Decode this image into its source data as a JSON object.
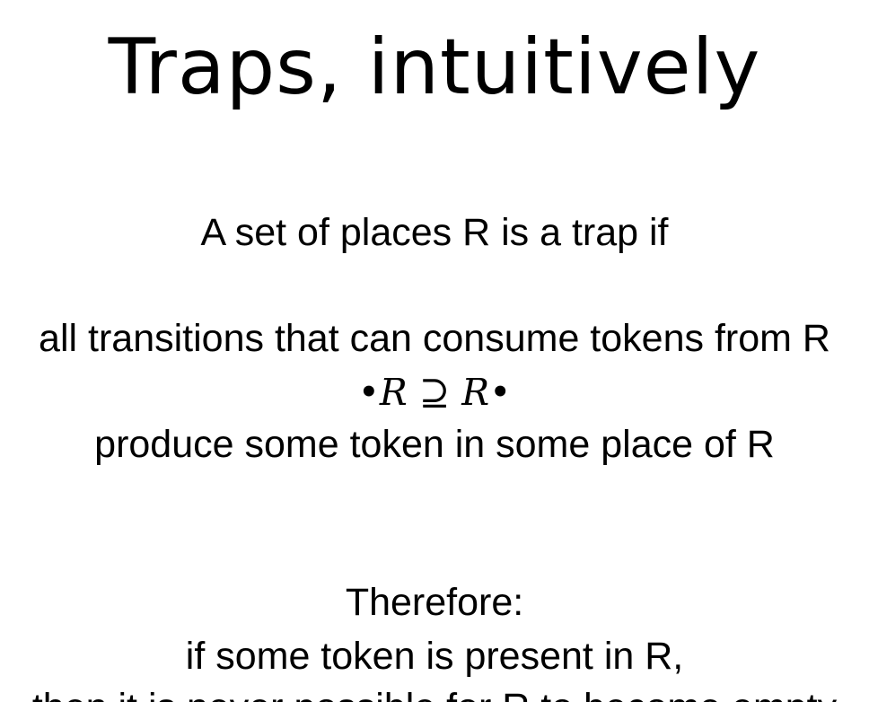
{
  "slide": {
    "title": "Traps, intuitively",
    "intro": "A set of places R is a trap if",
    "condition": "all transitions that can consume tokens from R",
    "formula": {
      "left_bullet": "•",
      "left_symbol": "R",
      "operator": "⊇",
      "right_symbol": "R",
      "right_bullet": "•"
    },
    "produce": "produce some token in some place of R",
    "therefore_label": "Therefore:",
    "therefore_line1": "if some token is present in R,",
    "therefore_line2": "then it is never possible for R to become empty"
  }
}
